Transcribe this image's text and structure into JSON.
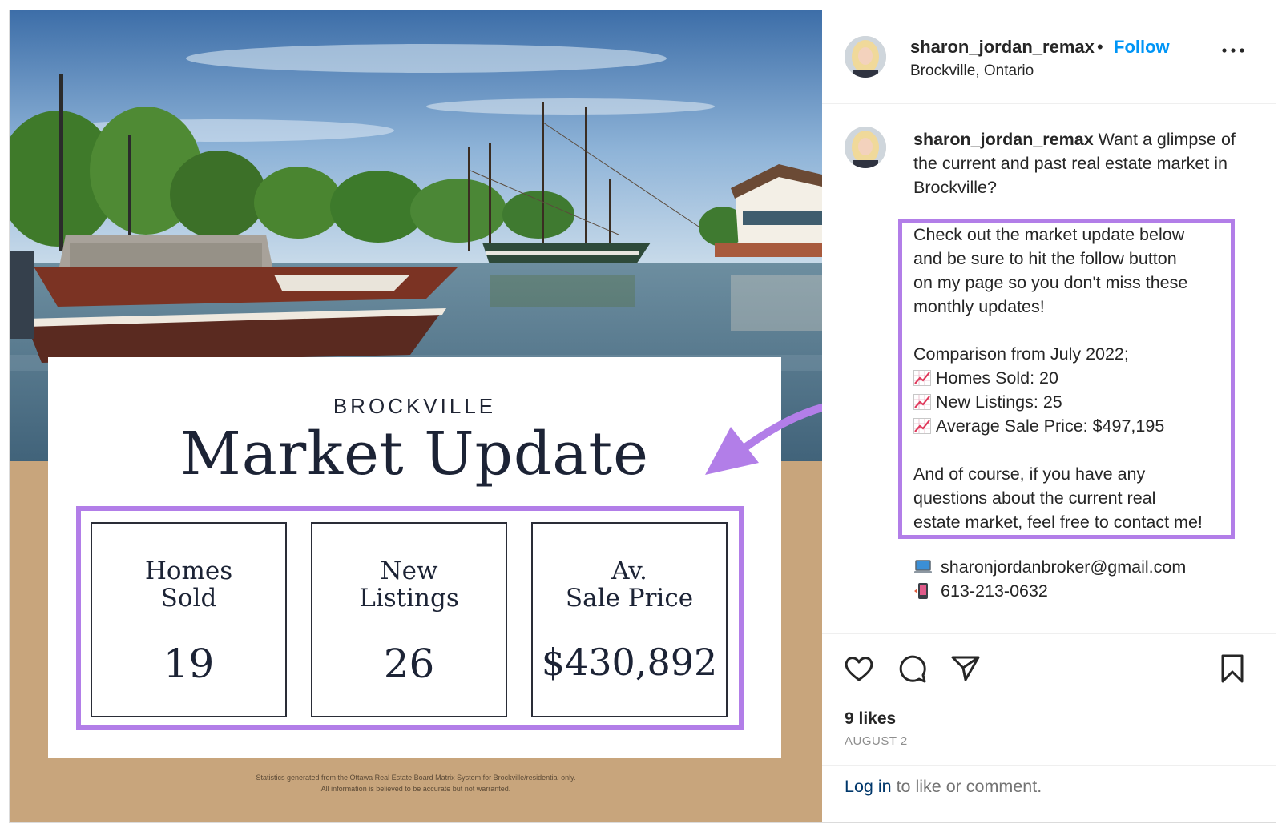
{
  "post": {
    "username": "sharon_jordan_remax",
    "separator": "•",
    "follow_label": "Follow",
    "location": "Brockville, Ontario",
    "more_icon": "more-horizontal-icon"
  },
  "image": {
    "city": "BROCKVILLE",
    "title": "Market Update",
    "stats": [
      {
        "label_line1": "Homes",
        "label_line2": "Sold",
        "value": "19"
      },
      {
        "label_line1": "New",
        "label_line2": "Listings",
        "value": "26"
      },
      {
        "label_line1": "Av.",
        "label_line2": "Sale Price",
        "value": "$430,892"
      }
    ],
    "footnote_line1": "Statistics generated from the Ottawa Real Estate Board Matrix System for Brockville/residential only.",
    "footnote_line2": "All information is believed to be accurate but not warranted.",
    "highlight_color": "#b27ee8"
  },
  "caption": {
    "username": "sharon_jordan_remax",
    "intro": " Want a glimpse of the current and past real estate market in Brockville?",
    "body_lines": [
      {
        "text": "Check out the market update below",
        "emoji": ""
      },
      {
        "text": "and be sure to hit the follow button",
        "emoji": ""
      },
      {
        "text": "on my page so you don't miss these",
        "emoji": ""
      },
      {
        "text": "monthly updates!",
        "emoji": ""
      },
      {
        "text": "",
        "emoji": ""
      },
      {
        "text": "Comparison from July 2022;",
        "emoji": ""
      },
      {
        "text": "Homes Sold: 20",
        "emoji": "chart-increasing-icon"
      },
      {
        "text": "New Listings: 25",
        "emoji": "chart-increasing-icon"
      },
      {
        "text": "Average Sale Price: $497,195",
        "emoji": "chart-increasing-icon"
      },
      {
        "text": "",
        "emoji": ""
      },
      {
        "text": "And of course, if you have any",
        "emoji": ""
      },
      {
        "text": "questions about the current real",
        "emoji": ""
      },
      {
        "text": "estate market, feel free to contact me!",
        "emoji": ""
      }
    ],
    "email": "sharonjordanbroker@gmail.com",
    "email_icon": "laptop-icon",
    "phone": "613-213-0632",
    "phone_icon": "mobile-phone-icon"
  },
  "actions": {
    "like_icon": "heart-icon",
    "comment_icon": "comment-icon",
    "share_icon": "send-icon",
    "save_icon": "bookmark-icon"
  },
  "likes": "9 likes",
  "date": "AUGUST 2",
  "login": {
    "link_label": "Log in",
    "rest": " to like or comment."
  }
}
